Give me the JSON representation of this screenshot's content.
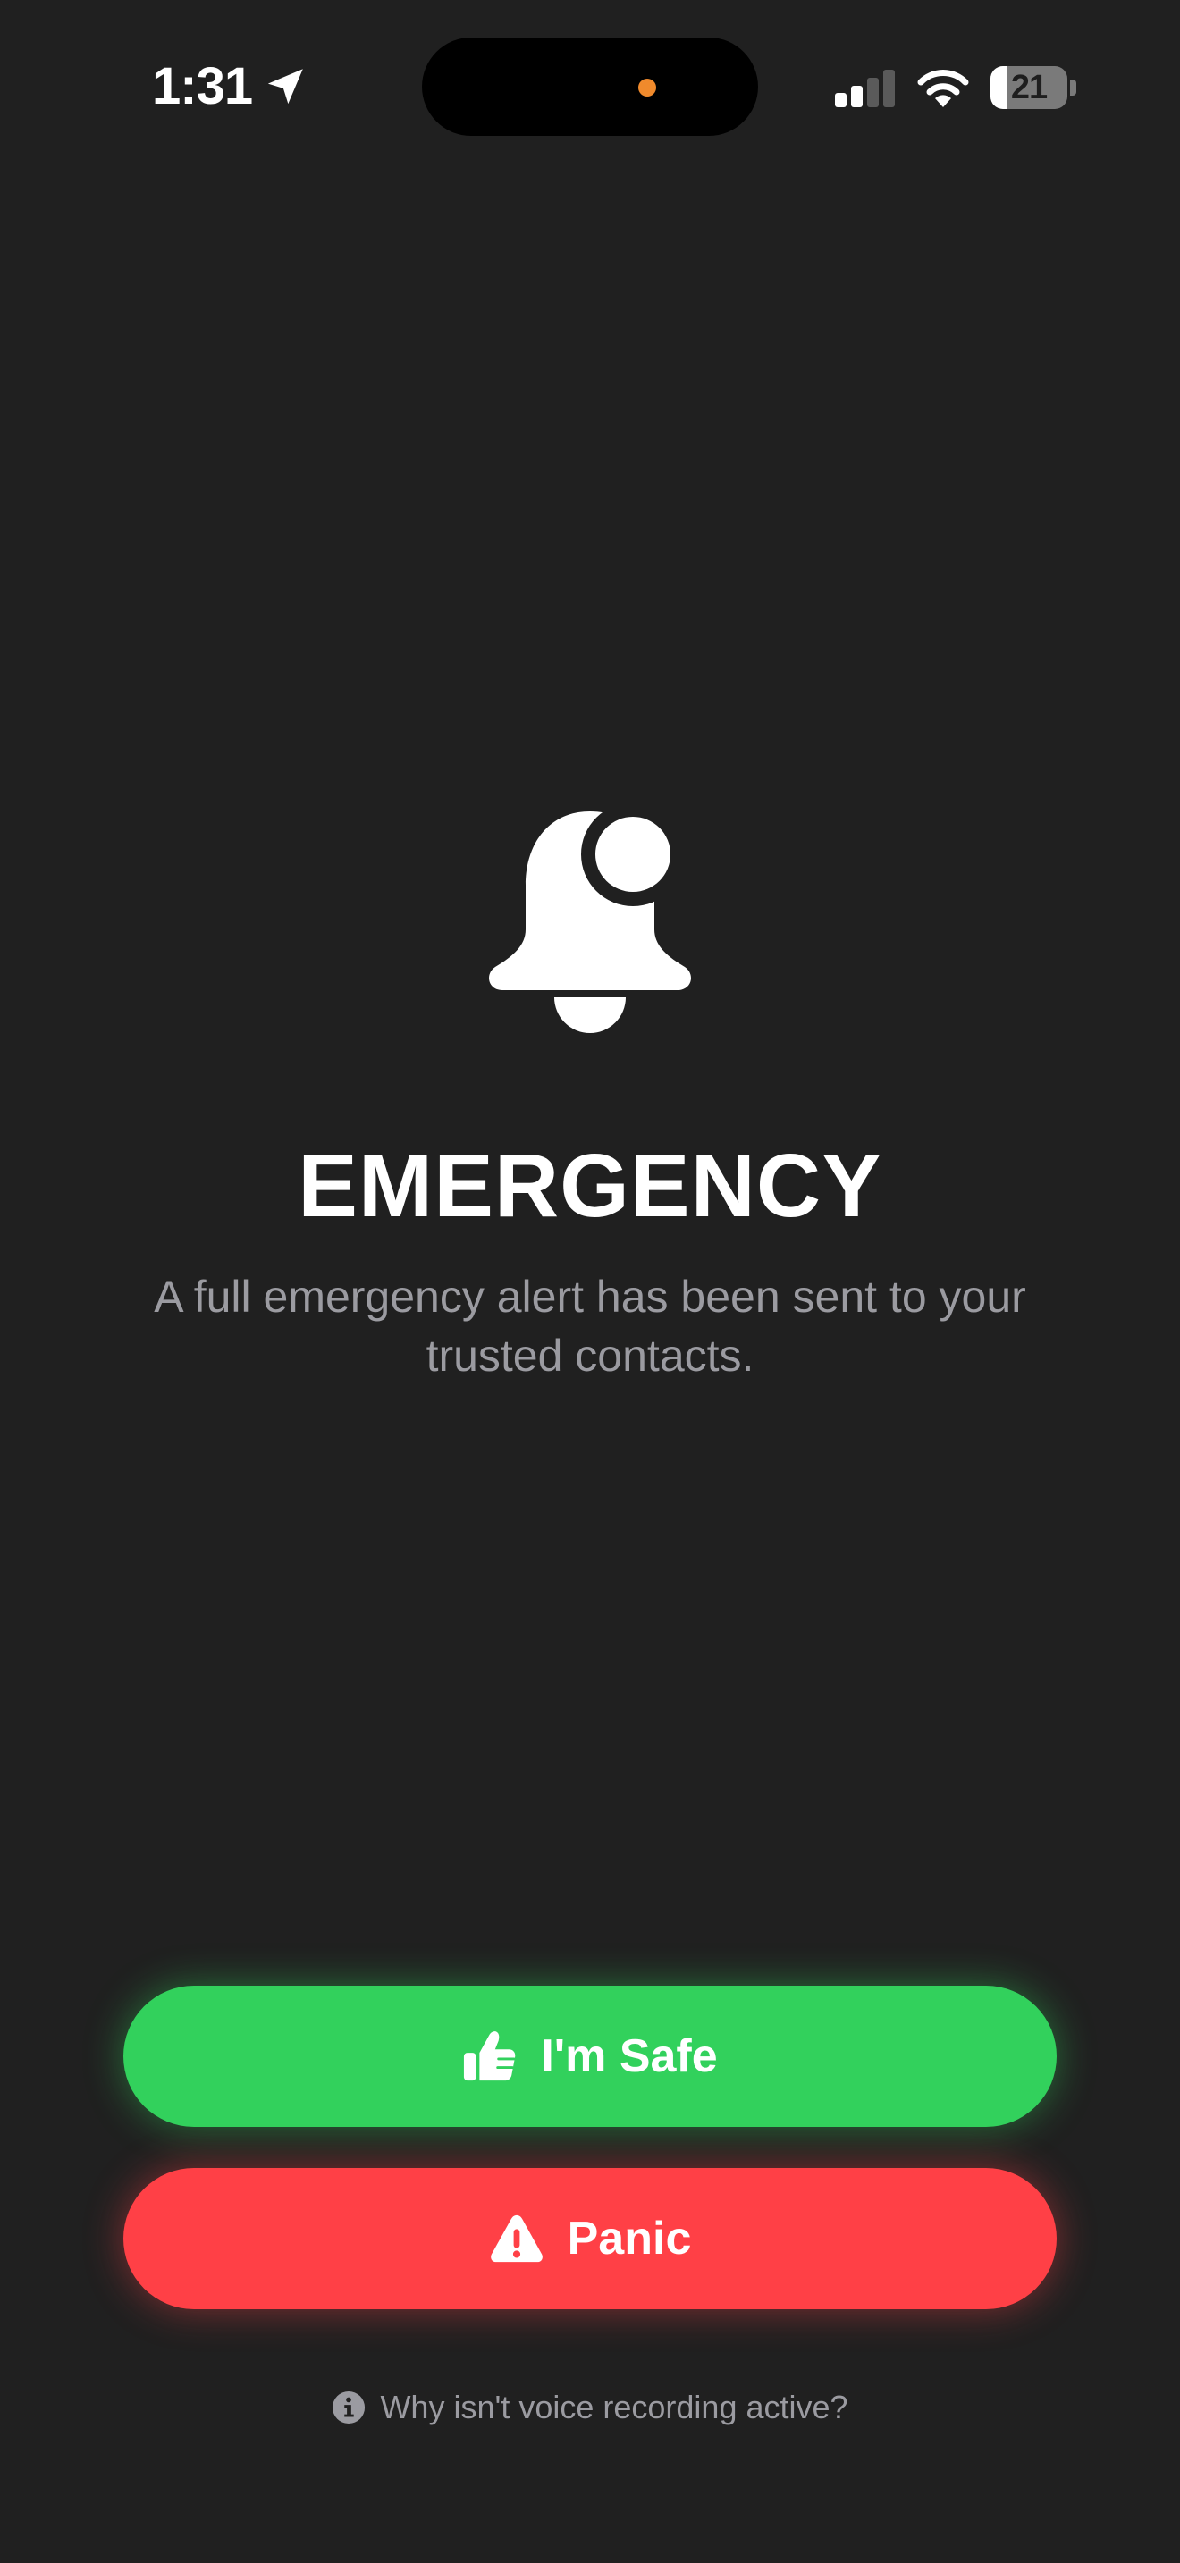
{
  "status_bar": {
    "time": "1:31",
    "battery_level": "21",
    "battery_fraction": 0.21,
    "signal_bars_active": 2,
    "signal_bars_total": 4,
    "icons": [
      "location-arrow-icon",
      "cellular-signal-icon",
      "wifi-icon",
      "battery-icon"
    ],
    "privacy_indicator_color": "#f08a2c"
  },
  "alert": {
    "icon": "bell-badge-icon",
    "title": "EMERGENCY",
    "message": "A full emergency alert has been sent to your trusted contacts."
  },
  "actions": {
    "safe": {
      "label": "I'm Safe",
      "icon": "thumbs-up-icon",
      "color": "#32d15c"
    },
    "panic": {
      "label": "Panic",
      "icon": "warning-triangle-icon",
      "color": "#ff4046"
    }
  },
  "footer": {
    "voice_link_label": "Why isn't voice recording active?",
    "icon": "info-icon"
  },
  "colors": {
    "background": "#202020",
    "text_primary": "#ffffff",
    "text_secondary": "#9b9ba1"
  }
}
